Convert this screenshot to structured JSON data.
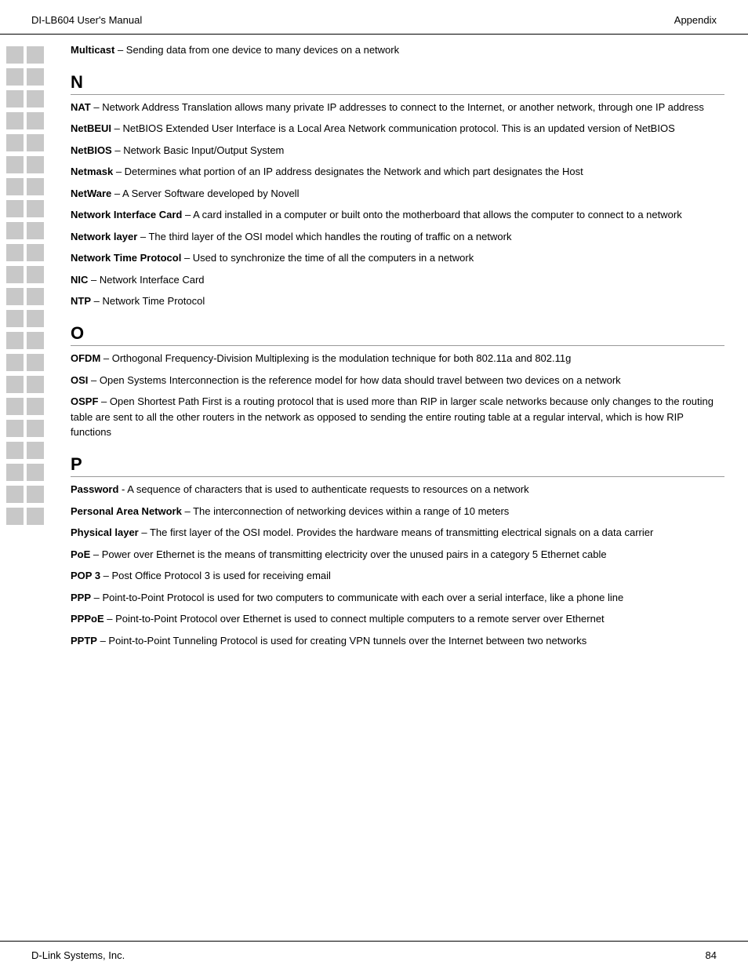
{
  "header": {
    "left": "DI-LB604 User's Manual",
    "right": "Appendix"
  },
  "footer": {
    "left": "D-Link Systems, Inc.",
    "right": "84"
  },
  "top_entry": {
    "term": "Multicast",
    "definition": " – Sending data from one device to many devices on a network"
  },
  "sections": [
    {
      "letter": "N",
      "entries": [
        {
          "term": "NAT",
          "definition": " – Network Address Translation allows many private IP addresses to connect to the Internet, or another network, through one IP address"
        },
        {
          "term": "NetBEUI",
          "definition": " – NetBIOS Extended User Interface is a Local Area Network communication protocol.  This is an updated version of NetBIOS"
        },
        {
          "term": "NetBIOS",
          "definition": " – Network Basic Input/Output System"
        },
        {
          "term": "Netmask",
          "definition": " – Determines what portion of an IP address designates the Network and which part designates the Host"
        },
        {
          "term": "NetWare",
          "definition": " – A Server Software developed by Novell"
        },
        {
          "term": "Network Interface Card",
          "definition": " – A card installed in a computer or built onto the motherboard that allows the computer to connect to a network"
        },
        {
          "term": "Network layer",
          "definition": " – The third layer of the OSI model which handles the routing of traffic on a network"
        },
        {
          "term": "Network Time Protocol",
          "definition": " – Used to synchronize the time of all the computers in a network"
        },
        {
          "term": "NIC",
          "definition": " – Network Interface Card"
        },
        {
          "term": "NTP",
          "definition": " – Network Time Protocol"
        }
      ]
    },
    {
      "letter": "O",
      "entries": [
        {
          "term": "OFDM",
          "definition": " – Orthogonal Frequency-Division Multiplexing is the modulation technique for both 802.11a and 802.11g"
        },
        {
          "term": "OSI",
          "definition": " – Open Systems Interconnection is the reference model for how data should travel between two devices on a network"
        },
        {
          "term": "OSPF",
          "definition": " – Open Shortest Path First is a routing protocol that is used more than RIP in larger scale networks because only changes to the routing table are sent to all the other routers in the network as opposed to sending the entire routing table at a regular interval, which is how RIP functions"
        }
      ]
    },
    {
      "letter": "P",
      "entries": [
        {
          "term": "Password",
          "definition": " -  A sequence of characters that is used to authenticate requests to resources on a network"
        },
        {
          "term": "Personal Area Network",
          "definition": " – The interconnection of networking devices within a range of 10 meters"
        },
        {
          "term": "Physical layer",
          "definition": " – The first layer of the OSI model.  Provides the hardware means of transmitting electrical signals on a data carrier"
        },
        {
          "term": "PoE",
          "definition": " – Power over Ethernet is the means of transmitting electricity over the unused pairs in a category 5 Ethernet cable"
        },
        {
          "term": "POP 3",
          "definition": " – Post Office Protocol 3 is used for receiving email"
        },
        {
          "term": "PPP",
          "definition": " – Point-to-Point Protocol is used for two computers to communicate with each over a serial interface, like a phone line"
        },
        {
          "term": "PPPoE",
          "definition": " – Point-to-Point Protocol over Ethernet is used to connect multiple computers to a remote server over Ethernet"
        },
        {
          "term": "PPTP",
          "definition": " – Point-to-Point Tunneling Protocol is used for creating VPN tunnels over the Internet between two networks"
        }
      ]
    }
  ],
  "sidebar_rows": 22
}
